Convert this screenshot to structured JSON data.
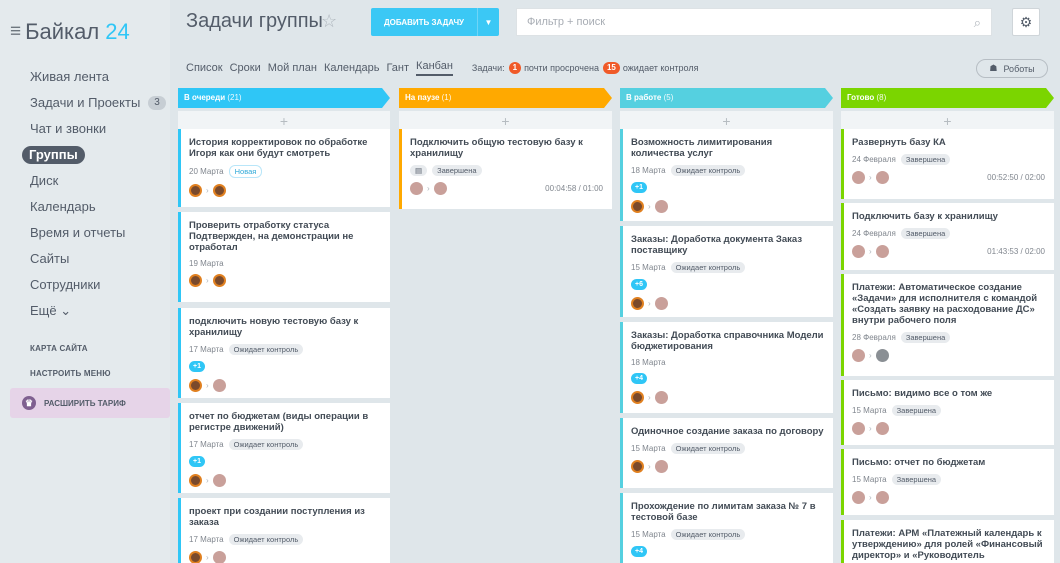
{
  "app": {
    "logo_main": "Байкал",
    "logo_num": "24"
  },
  "sidebar": {
    "items": [
      {
        "label": "Живая лента"
      },
      {
        "label": "Задачи и Проекты",
        "count": "3"
      },
      {
        "label": "Чат и звонки"
      },
      {
        "label": "Группы",
        "active": true
      },
      {
        "label": "Диск"
      },
      {
        "label": "Календарь"
      },
      {
        "label": "Время и отчеты"
      },
      {
        "label": "Сайты"
      },
      {
        "label": "Сотрудники"
      },
      {
        "label": "Ещё ⌄"
      }
    ],
    "map_link": "КАРТА САЙТА",
    "config_link": "НАСТРОИТЬ МЕНЮ",
    "tariff": "РАСШИРИТЬ ТАРИФ"
  },
  "header": {
    "title": "Задачи группы",
    "add_task": "ДОБАВИТЬ ЗАДАЧУ",
    "filter_placeholder": "Фильтр + поиск"
  },
  "views": {
    "tabs": [
      "Список",
      "Сроки",
      "Мой план",
      "Календарь",
      "Гант",
      "Канбан"
    ],
    "active": "Канбан",
    "tasks_label": "Задачи:",
    "overdue_count": "1",
    "overdue_text": "почти просрочена",
    "control_count": "15",
    "control_text": "ожидает контроля",
    "robots": "Роботы"
  },
  "colors": {
    "queue": "#2fc6f6",
    "paused": "#ffa900",
    "progress": "#55d0e0",
    "done": "#7bd500"
  },
  "columns": [
    {
      "name": "В очереди",
      "count": "(21)",
      "cards": [
        {
          "title": "История корректировок по обработке Игоря как они будут смотреть",
          "date": "20 Марта",
          "tag": "Новая"
        },
        {
          "title": "Проверить отработку статуса Подтвержден, на демонстрации не отработал",
          "date": "19 Марта"
        },
        {
          "title": "подключить новую тестовую базу к хранилищу",
          "date": "17 Марта",
          "tag": "Ожидает контроль",
          "chip": "+1"
        },
        {
          "title": "отчет по бюджетам (виды операции в регистре движений)",
          "date": "17 Марта",
          "tag": "Ожидает контроль",
          "chip": "+1"
        },
        {
          "title": "проект при создании поступления из заказа",
          "date": "17 Марта",
          "tag": "Ожидает контроль"
        }
      ]
    },
    {
      "name": "На паузе",
      "count": "(1)",
      "cards": [
        {
          "title": "Подключить общую тестовую базу к хранилищу",
          "tag": "Завершена",
          "timer": "00:04:58 / 01:00"
        }
      ]
    },
    {
      "name": "В работе",
      "count": "(5)",
      "cards": [
        {
          "title": "Возможность лимитирования количества услуг",
          "date": "18 Марта",
          "tag": "Ожидает контроль",
          "chip": "+1"
        },
        {
          "title": "Заказы: Доработка документа Заказ поставщику",
          "date": "15 Марта",
          "tag": "Ожидает контроль",
          "chip": "+6"
        },
        {
          "title": "Заказы: Доработка справочника Модели бюджетирования",
          "date": "18 Марта",
          "chip": "+4"
        },
        {
          "title": "Одиночное создание заказа по договору",
          "date": "15 Марта",
          "tag": "Ожидает контроль"
        },
        {
          "title": "Прохождение по лимитам заказа № 7 в тестовой базе",
          "date": "15 Марта",
          "tag": "Ожидает контроль",
          "chip": "+4"
        }
      ]
    },
    {
      "name": "Готово",
      "count": "(8)",
      "cards": [
        {
          "title": "Развернуть базу КА",
          "date": "24 Февраля",
          "tag": "Завершена",
          "timer": "00:52:50 / 02:00"
        },
        {
          "title": "Подключить базу к хранилищу",
          "date": "24 Февраля",
          "tag": "Завершена",
          "timer": "01:43:53 / 02:00"
        },
        {
          "title": "Платежи: Автоматическое создание «Задачи» для исполнителя с командой «Создать заявку на расходование ДС» внутри рабочего поля",
          "date": "28 Февраля",
          "tag": "Завершена"
        },
        {
          "title": "Письмо: видимо все о том же",
          "date": "15 Марта",
          "tag": "Завершена"
        },
        {
          "title": "Письмо: отчет по бюджетам",
          "date": "15 Марта",
          "tag": "Завершена"
        },
        {
          "title": "Платежи: АРМ «Платежный календарь к утверждению» для ролей «Финансовый директор» и «Руководитель"
        }
      ]
    }
  ]
}
